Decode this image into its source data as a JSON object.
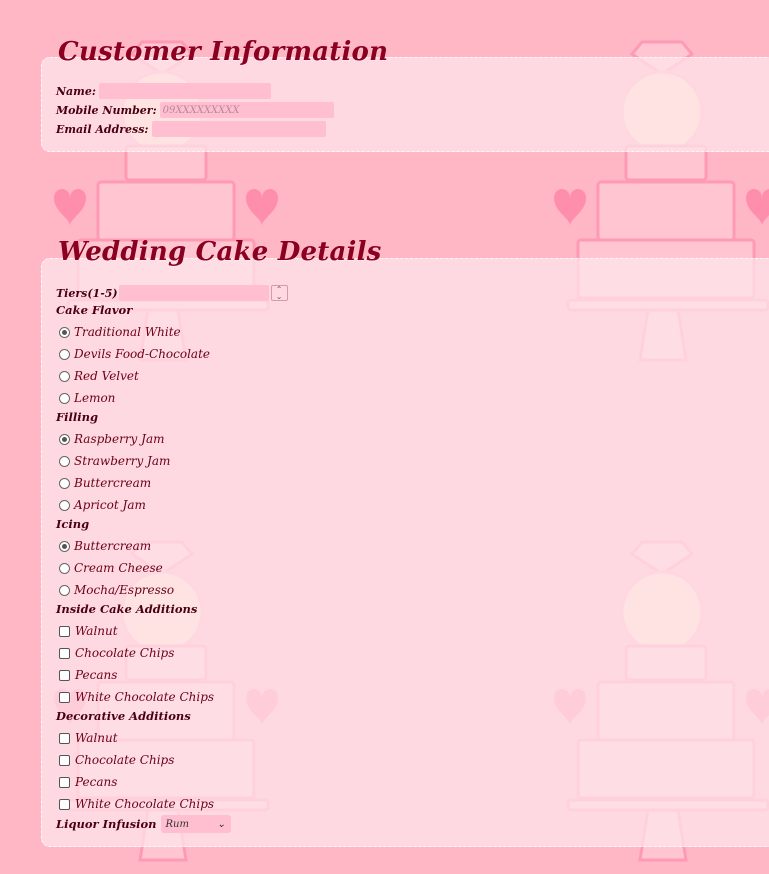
{
  "customer": {
    "title": "Customer Information",
    "name_label": "Name:",
    "name_value": "",
    "mobile_label": "Mobile Number:",
    "mobile_placeholder": "09XXXXXXXXX",
    "email_label": "Email Address:",
    "email_value": ""
  },
  "cake": {
    "title": "Wedding Cake Details",
    "tiers_label": "Tiers(1-5)",
    "tiers_value": "",
    "flavor": {
      "heading": "Cake Flavor",
      "options": [
        "Traditional White",
        "Devils Food-Chocolate",
        "Red Velvet",
        "Lemon"
      ],
      "selected": "Traditional White"
    },
    "filling": {
      "heading": "Filling",
      "options": [
        "Raspberry Jam",
        "Strawberry Jam",
        "Buttercream",
        "Apricot Jam"
      ],
      "selected": "Raspberry Jam"
    },
    "icing": {
      "heading": "Icing",
      "options": [
        "Buttercream",
        "Cream Cheese",
        "Mocha/Espresso"
      ],
      "selected": "Buttercream"
    },
    "inside_additions": {
      "heading": "Inside Cake Additions",
      "options": [
        "Walnut",
        "Chocolate Chips",
        "Pecans",
        "White Chocolate Chips"
      ]
    },
    "decorative_additions": {
      "heading": "Decorative Additions",
      "options": [
        "Walnut",
        "Chocolate Chips",
        "Pecans",
        "White Chocolate Chips"
      ]
    },
    "liquor": {
      "label": "Liquor Infusion",
      "selected": "Rum"
    }
  },
  "colors": {
    "page_background": "#ffb7c5",
    "heading_color": "#8b0020",
    "input_background": "#ffbfd0"
  }
}
